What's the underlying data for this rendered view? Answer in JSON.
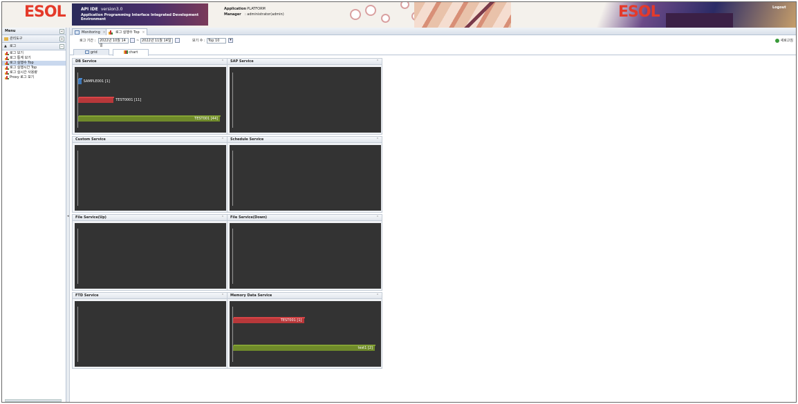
{
  "header": {
    "logo_text": "ESOL",
    "app_title": "API IDE",
    "version": "version3.0",
    "subtitle": "Application Programming Interface Integrated Development Environment",
    "application_label": "Application",
    "application_value": ": PLATFORM",
    "manager_label": "Manager",
    "manager_value": ": administrator(admin)",
    "logout": "Logout"
  },
  "sidebar": {
    "title": "Menu",
    "sections": [
      {
        "label": "관리도구",
        "toggle": "+"
      },
      {
        "label": "로그",
        "toggle": "−"
      }
    ],
    "items": [
      {
        "label": "로그 보기"
      },
      {
        "label": "로그 통계 보기"
      },
      {
        "label": "로그 실행수 Top"
      },
      {
        "label": "로그 실행시간 Top"
      },
      {
        "label": "로그 실시간 사용량"
      },
      {
        "label": "Proxy 로그 보기"
      }
    ],
    "selected_index": 2
  },
  "tabs": [
    {
      "label": "Monitoring"
    },
    {
      "label": "로그 실행수 Top"
    }
  ],
  "toolbar": {
    "period_label": "로그 기간 :",
    "start_date": "2022년 10월 14일",
    "separator": "~",
    "end_date": "2022년 11월 14일",
    "count_label": "보기 수 :",
    "count_value": "Top 10",
    "refresh_label": "새로고침"
  },
  "view_tabs": [
    {
      "label": "grid"
    },
    {
      "label": "chart"
    }
  ],
  "colors": {
    "accent_red": "#e43a2a",
    "bar_blue": "#3f78b8",
    "bar_red": "#b8383a",
    "bar_green": "#6f8a2a",
    "chart_bg": "#333333"
  },
  "panels": [
    {
      "title": "DB Service",
      "chart_data": {
        "type": "bar",
        "orientation": "horizontal",
        "categories": [
          "SAMPLE001",
          "TEST0001",
          "TEST001"
        ],
        "series": [
          {
            "values": [
              1,
              11,
              44
            ]
          }
        ],
        "labels": [
          "SAMPLE001 [1]",
          "TEST0001 [11]",
          "TEST001 [44]"
        ],
        "colors": [
          "#3f78b8",
          "#b8383a",
          "#6f8a2a"
        ],
        "max": 44,
        "label_position": [
          "outside",
          "outside",
          "inside"
        ]
      }
    },
    {
      "title": "SAP Service",
      "chart_data": {
        "type": "bar",
        "orientation": "horizontal",
        "categories": [],
        "series": [
          {
            "values": []
          }
        ]
      }
    },
    {
      "title": "Custom Service",
      "chart_data": {
        "type": "bar",
        "orientation": "horizontal",
        "categories": [],
        "series": [
          {
            "values": []
          }
        ]
      }
    },
    {
      "title": "Schedule Service",
      "chart_data": {
        "type": "bar",
        "orientation": "horizontal",
        "categories": [],
        "series": [
          {
            "values": []
          }
        ]
      }
    },
    {
      "title": "File Service(Up)",
      "chart_data": {
        "type": "bar",
        "orientation": "horizontal",
        "categories": [],
        "series": [
          {
            "values": []
          }
        ]
      }
    },
    {
      "title": "File Service(Down)",
      "chart_data": {
        "type": "bar",
        "orientation": "horizontal",
        "categories": [],
        "series": [
          {
            "values": []
          }
        ]
      }
    },
    {
      "title": "FTD Service",
      "chart_data": {
        "type": "bar",
        "orientation": "horizontal",
        "categories": [],
        "series": [
          {
            "values": []
          }
        ]
      }
    },
    {
      "title": "Memory Data Service",
      "chart_data": {
        "type": "bar",
        "orientation": "horizontal",
        "categories": [
          "TEST001",
          "test1"
        ],
        "series": [
          {
            "values": [
              1,
              2
            ]
          }
        ],
        "labels": [
          "TEST001 [1]",
          "test1 [2]"
        ],
        "colors": [
          "#b8383a",
          "#6f8a2a"
        ],
        "max": 2,
        "label_position": [
          "inside",
          "inside"
        ]
      }
    }
  ]
}
